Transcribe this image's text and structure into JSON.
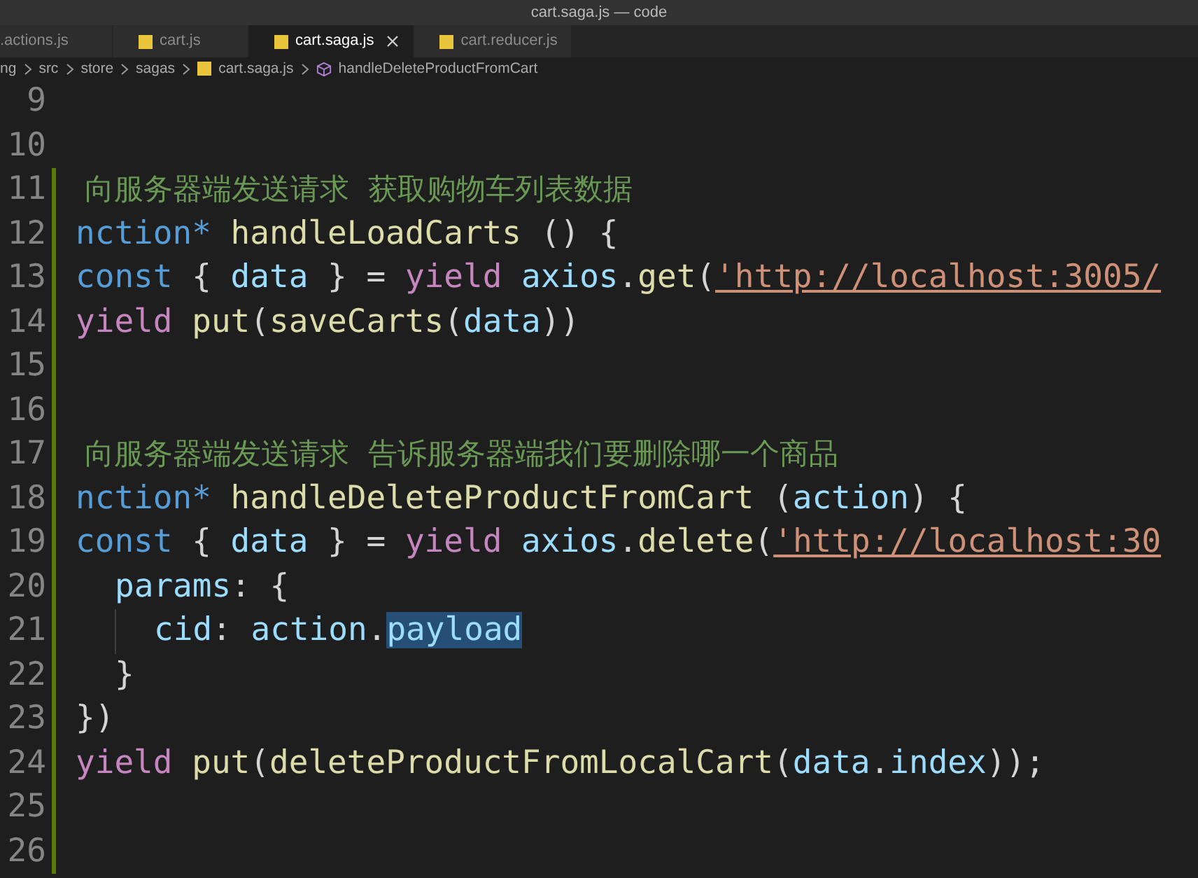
{
  "window": {
    "title": "cart.saga.js — code"
  },
  "tabs": [
    {
      "label": ".actions.js",
      "icon": false,
      "selected": false
    },
    {
      "label": "cart.js",
      "icon": true,
      "selected": false
    },
    {
      "label": "cart.saga.js",
      "icon": true,
      "selected": true
    },
    {
      "label": "cart.reducer.js",
      "icon": true,
      "selected": false
    }
  ],
  "breadcrumb": [
    {
      "label": "ng",
      "kind": "folder"
    },
    {
      "label": "src",
      "kind": "folder"
    },
    {
      "label": "store",
      "kind": "folder"
    },
    {
      "label": "sagas",
      "kind": "folder"
    },
    {
      "label": "cart.saga.js",
      "kind": "file"
    },
    {
      "label": "handleDeleteProductFromCart",
      "kind": "symbol"
    }
  ],
  "lines": [
    {
      "number": "9",
      "modified": false
    },
    {
      "number": "10",
      "modified": false
    },
    {
      "number": "11",
      "modified": true,
      "tokens": [
        {
          "text": " 向服务器端发送请求  获取购物车列表数据",
          "kind": "comment"
        }
      ]
    },
    {
      "number": "12",
      "modified": true,
      "tokens": [
        {
          "text": "nction* ",
          "kind": "keyword"
        },
        {
          "text": "handleLoadCarts",
          "kind": "func"
        },
        {
          "text": " () {",
          "kind": "plain"
        }
      ]
    },
    {
      "number": "13",
      "modified": true,
      "tokens": [
        {
          "text": "const",
          "kind": "keyword"
        },
        {
          "text": " { ",
          "kind": "plain"
        },
        {
          "text": "data",
          "kind": "var"
        },
        {
          "text": " } = ",
          "kind": "plain"
        },
        {
          "text": "yield ",
          "kind": "control"
        },
        {
          "text": "axios",
          "kind": "var"
        },
        {
          "text": ".",
          "kind": "plain"
        },
        {
          "text": "get",
          "kind": "func"
        },
        {
          "text": "(",
          "kind": "plain"
        },
        {
          "text": "'http://localhost:3005/",
          "kind": "string"
        }
      ]
    },
    {
      "number": "14",
      "modified": true,
      "tokens": [
        {
          "text": "yield ",
          "kind": "control"
        },
        {
          "text": "put",
          "kind": "func"
        },
        {
          "text": "(",
          "kind": "plain"
        },
        {
          "text": "saveCarts",
          "kind": "func"
        },
        {
          "text": "(",
          "kind": "plain"
        },
        {
          "text": "data",
          "kind": "var"
        },
        {
          "text": "))",
          "kind": "plain"
        }
      ]
    },
    {
      "number": "15",
      "modified": true
    },
    {
      "number": "16",
      "modified": true
    },
    {
      "number": "17",
      "modified": true,
      "tokens": [
        {
          "text": " 向服务器端发送请求  告诉服务器端我们要删除哪一个商品",
          "kind": "comment"
        }
      ]
    },
    {
      "number": "18",
      "modified": true,
      "tokens": [
        {
          "text": "nction* ",
          "kind": "keyword"
        },
        {
          "text": "handleDeleteProductFromCart",
          "kind": "func"
        },
        {
          "text": " (",
          "kind": "plain"
        },
        {
          "text": "action",
          "kind": "var"
        },
        {
          "text": ") {",
          "kind": "plain"
        }
      ]
    },
    {
      "number": "19",
      "modified": true,
      "tokens": [
        {
          "text": "const",
          "kind": "keyword"
        },
        {
          "text": " { ",
          "kind": "plain"
        },
        {
          "text": "data",
          "kind": "var"
        },
        {
          "text": " } = ",
          "kind": "plain"
        },
        {
          "text": "yield ",
          "kind": "control"
        },
        {
          "text": "axios",
          "kind": "var"
        },
        {
          "text": ".",
          "kind": "plain"
        },
        {
          "text": "delete",
          "kind": "func"
        },
        {
          "text": "(",
          "kind": "plain"
        },
        {
          "text": "'http://localhost:30",
          "kind": "string"
        }
      ],
      "children": [
        {
          "number": "20",
          "modified": true,
          "tokens": [
            {
              "text": "params",
              "kind": "var"
            },
            {
              "text": ": {",
              "kind": "plain"
            }
          ],
          "children": [
            {
              "number": "21",
              "modified": true,
              "tokens": [
                {
                  "text": "cid",
                  "kind": "var"
                },
                {
                  "text": ": ",
                  "kind": "plain"
                },
                {
                  "text": "action",
                  "kind": "var"
                },
                {
                  "text": ".",
                  "kind": "plain"
                },
                {
                  "text": "payload",
                  "kind": "var",
                  "selected": true
                }
              ]
            }
          ]
        },
        {
          "number": "22",
          "modified": true,
          "tokens": [
            {
              "text": "}",
              "kind": "plain"
            }
          ]
        }
      ]
    },
    {
      "number": "23",
      "modified": true,
      "tokens": [
        {
          "text": "})",
          "kind": "plain"
        }
      ]
    },
    {
      "number": "24",
      "modified": true,
      "tokens": [
        {
          "text": "yield ",
          "kind": "control"
        },
        {
          "text": "put",
          "kind": "func"
        },
        {
          "text": "(",
          "kind": "plain"
        },
        {
          "text": "deleteProductFromLocalCart",
          "kind": "func"
        },
        {
          "text": "(",
          "kind": "plain"
        },
        {
          "text": "data",
          "kind": "var"
        },
        {
          "text": ".",
          "kind": "plain"
        },
        {
          "text": "index",
          "kind": "var"
        },
        {
          "text": "));",
          "kind": "plain"
        }
      ]
    },
    {
      "number": "25",
      "modified": true
    },
    {
      "number": "26",
      "modified": true
    }
  ]
}
